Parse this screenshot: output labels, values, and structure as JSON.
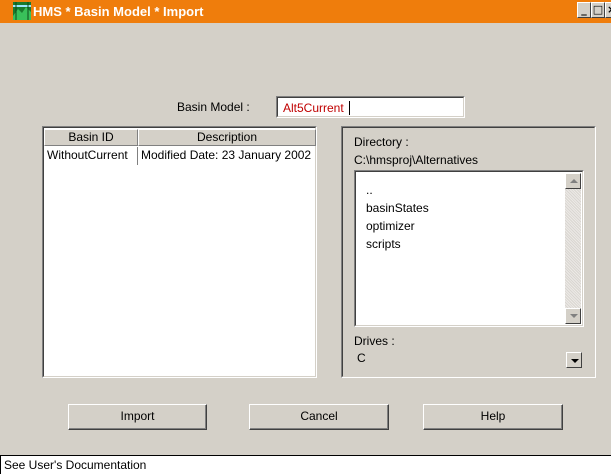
{
  "window": {
    "title": "HMS * Basin Model * Import",
    "icon": "hms-app-icon",
    "title_color": "#ef7d0c",
    "controls": {
      "minimize": "_",
      "maximize": "□",
      "close": "×"
    }
  },
  "form": {
    "basin_model_label": "Basin Model :",
    "basin_model_value": "Alt5Current",
    "value_color": "#c00000"
  },
  "basin_table": {
    "columns": [
      "Basin ID",
      "Description"
    ],
    "rows": [
      {
        "basin_id": "WithoutCurrent",
        "description": "Modified Date: 23 January 2002"
      }
    ]
  },
  "file_browser": {
    "directory_label": "Directory :",
    "directory_path": "C:\\hmsproj\\Alternatives",
    "entries": [
      "..",
      "basinStates",
      "optimizer",
      "scripts"
    ],
    "drives_label": "Drives :",
    "drive_value": "C"
  },
  "buttons": {
    "import": "Import",
    "cancel": "Cancel",
    "help": "Help"
  },
  "status": {
    "text": "See User's Documentation"
  }
}
